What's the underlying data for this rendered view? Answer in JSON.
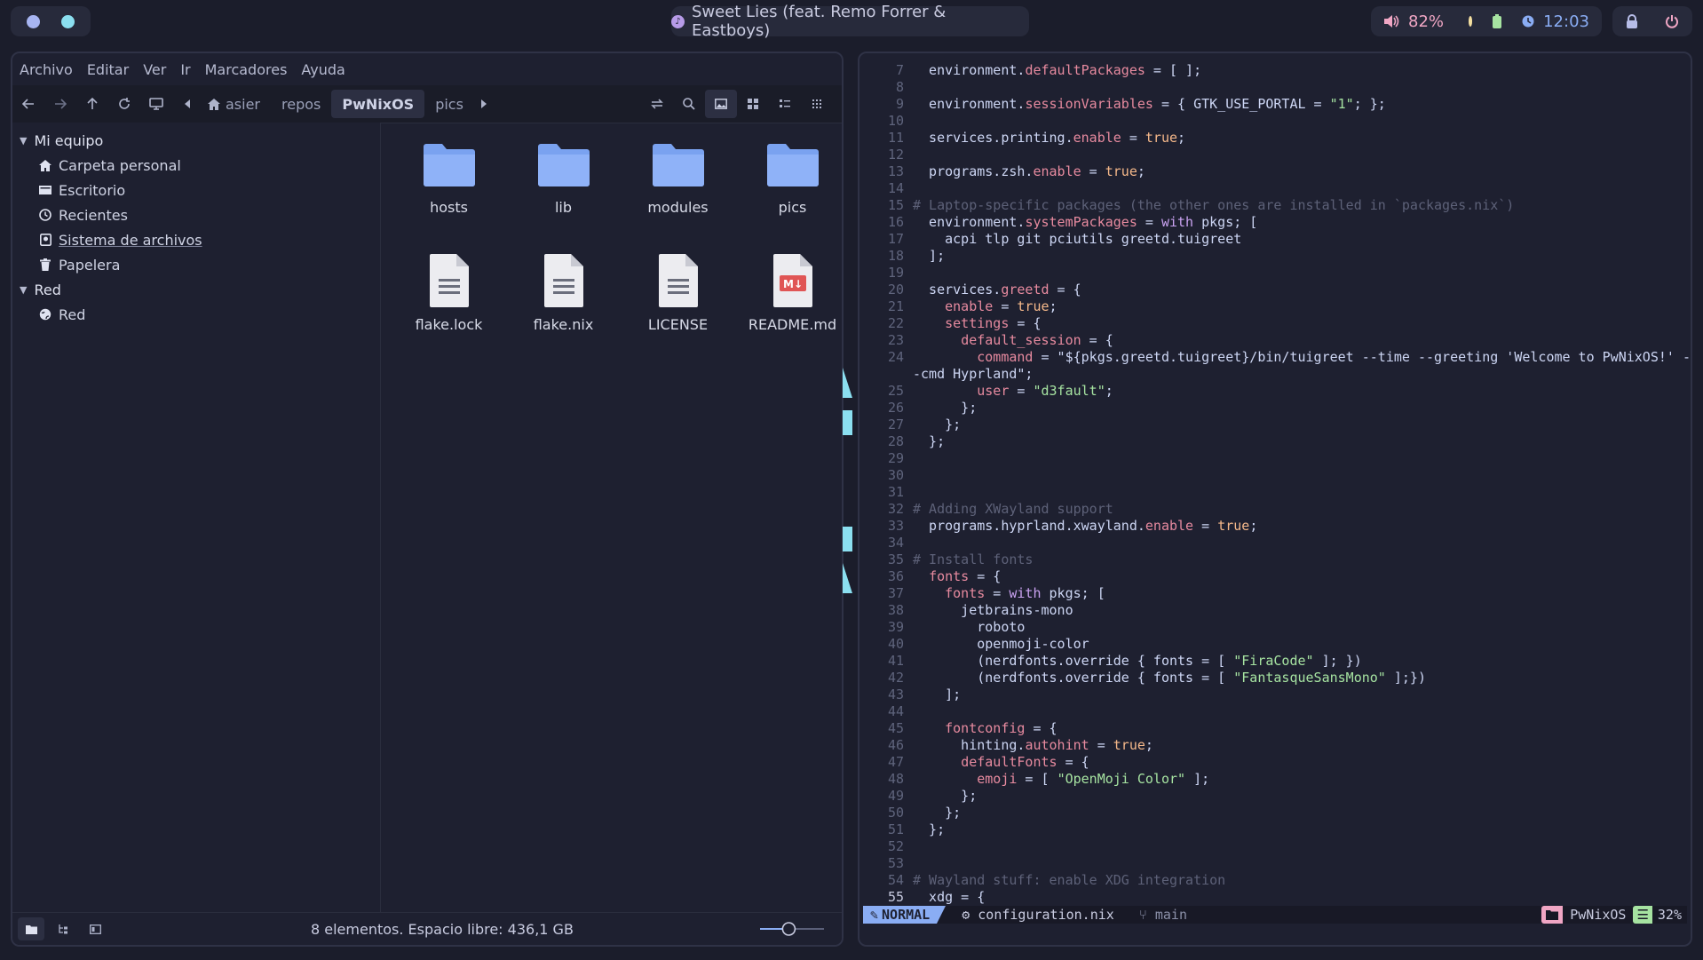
{
  "topbar": {
    "workspaces": [
      {
        "name": "ws-1",
        "color": "#a7b5f2"
      },
      {
        "name": "ws-2",
        "color": "#8bdff0"
      }
    ],
    "media_title": "Sweet Lies (feat. Remo Forrer & Eastboys)",
    "volume": "82%",
    "clock": "12:03",
    "icons": [
      "volume-icon",
      "battery-icon",
      "clock-icon",
      "lock-icon",
      "power-icon"
    ]
  },
  "file_manager": {
    "menu": [
      "Archivo",
      "Editar",
      "Ver",
      "Ir",
      "Marcadores",
      "Ayuda"
    ],
    "path": {
      "home": "asier",
      "segments": [
        "repos",
        "PwNixOS",
        "pics"
      ],
      "active": "PwNixOS"
    },
    "sidebar": {
      "mi_equipo": "Mi equipo",
      "items": [
        "Carpeta personal",
        "Escritorio",
        "Recientes",
        "Sistema de archivos",
        "Papelera"
      ],
      "red_header": "Red",
      "red_items": [
        "Red"
      ]
    },
    "files": [
      {
        "name": "hosts",
        "type": "folder"
      },
      {
        "name": "lib",
        "type": "folder"
      },
      {
        "name": "modules",
        "type": "folder"
      },
      {
        "name": "pics",
        "type": "folder"
      },
      {
        "name": "flake.lock",
        "type": "text"
      },
      {
        "name": "flake.nix",
        "type": "text"
      },
      {
        "name": "LICENSE",
        "type": "text"
      },
      {
        "name": "README.md",
        "type": "markdown"
      }
    ],
    "status": "8 elementos. Espacio libre: 436,1 GB",
    "zoom_level": 0.45,
    "colors": {
      "folder": "#8fb2f8",
      "folder_tab": "#7aa2f0",
      "accent": "#8aadf4"
    }
  },
  "editor": {
    "lines": [
      {
        "n": "7",
        "t": "  environment.defaultPackages = [ ];"
      },
      {
        "n": "8",
        "t": ""
      },
      {
        "n": "9",
        "t": "  environment.sessionVariables = { GTK_USE_PORTAL = \"1\"; };"
      },
      {
        "n": "10",
        "t": ""
      },
      {
        "n": "11",
        "t": "  services.printing.enable = true;"
      },
      {
        "n": "12",
        "t": ""
      },
      {
        "n": "13",
        "t": "  programs.zsh.enable = true;"
      },
      {
        "n": "14",
        "t": ""
      },
      {
        "n": "15",
        "t": "# Laptop-specific packages (the other ones are installed in `packages.nix`)"
      },
      {
        "n": "16",
        "t": "  environment.systemPackages = with pkgs; ["
      },
      {
        "n": "17",
        "t": "    acpi tlp git pciutils greetd.tuigreet"
      },
      {
        "n": "18",
        "t": "  ];"
      },
      {
        "n": "19",
        "t": ""
      },
      {
        "n": "20",
        "t": "  services.greetd = {"
      },
      {
        "n": "21",
        "t": "    enable = true;"
      },
      {
        "n": "22",
        "t": "    settings = {"
      },
      {
        "n": "23",
        "t": "      default_session = {"
      },
      {
        "n": "24",
        "t": "        command = \"${pkgs.greetd.tuigreet}/bin/tuigreet --time --greeting 'Welcome to PwNixOS!' -"
      },
      {
        "n": "",
        "t": "-cmd Hyprland\";"
      },
      {
        "n": "25",
        "t": "        user = \"d3fault\";"
      },
      {
        "n": "26",
        "t": "      };"
      },
      {
        "n": "27",
        "t": "    };"
      },
      {
        "n": "28",
        "t": "  };"
      },
      {
        "n": "29",
        "t": ""
      },
      {
        "n": "30",
        "t": ""
      },
      {
        "n": "31",
        "t": ""
      },
      {
        "n": "32",
        "t": "# Adding XWayland support"
      },
      {
        "n": "33",
        "t": "  programs.hyprland.xwayland.enable = true;"
      },
      {
        "n": "34",
        "t": ""
      },
      {
        "n": "35",
        "t": "# Install fonts"
      },
      {
        "n": "36",
        "t": "  fonts = {"
      },
      {
        "n": "37",
        "t": "    fonts = with pkgs; ["
      },
      {
        "n": "38",
        "t": "      jetbrains-mono"
      },
      {
        "n": "39",
        "t": "        roboto"
      },
      {
        "n": "40",
        "t": "        openmoji-color"
      },
      {
        "n": "41",
        "t": "        (nerdfonts.override { fonts = [ \"FiraCode\" ]; })"
      },
      {
        "n": "42",
        "t": "        (nerdfonts.override { fonts = [ \"FantasqueSansMono\" ];})"
      },
      {
        "n": "43",
        "t": "    ];"
      },
      {
        "n": "44",
        "t": ""
      },
      {
        "n": "45",
        "t": "    fontconfig = {"
      },
      {
        "n": "46",
        "t": "      hinting.autohint = true;"
      },
      {
        "n": "47",
        "t": "      defaultFonts = {"
      },
      {
        "n": "48",
        "t": "        emoji = [ \"OpenMoji Color\" ];"
      },
      {
        "n": "49",
        "t": "      };"
      },
      {
        "n": "50",
        "t": "    };"
      },
      {
        "n": "51",
        "t": "  };"
      },
      {
        "n": "52",
        "t": ""
      },
      {
        "n": "53",
        "t": ""
      },
      {
        "n": "54",
        "t": "# Wayland stuff: enable XDG integration"
      },
      {
        "n": "55",
        "t": "  xdg = {"
      }
    ],
    "statusline": {
      "mode": "NORMAL",
      "file": "configuration.nix",
      "branch": "main",
      "project": "PwNixOS",
      "percent": "32%"
    },
    "colors": {
      "mode_bg": "#8aadf4",
      "project_bg": "#f0a6c4",
      "percent_bg": "#a6e3a1"
    }
  }
}
